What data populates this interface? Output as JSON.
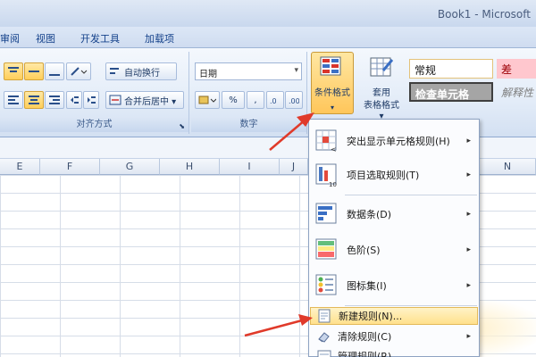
{
  "window": {
    "title": "Book1 - Microsoft"
  },
  "tabs": [
    {
      "label": "审阅"
    },
    {
      "label": "视图"
    },
    {
      "label": "开发工具"
    },
    {
      "label": "加载项"
    }
  ],
  "ribbon": {
    "alignment": {
      "wrap_text": "自动换行",
      "merge_center": "合并后居中 ▾",
      "label": "对齐方式"
    },
    "number": {
      "format_value": "日期",
      "percent": "%",
      "comma": ",",
      "label": "数字"
    },
    "styles": {
      "conditional_format": "条件格式",
      "table_format_line1": "套用",
      "table_format_line2": "表格格式 ▾",
      "normal": "常规",
      "bad": "差",
      "check_cell": "检查单元格",
      "explanatory": "解释性"
    }
  },
  "columns": [
    "E",
    "F",
    "G",
    "H",
    "I",
    "J",
    "N"
  ],
  "menu": {
    "items": [
      {
        "label": "突出显示单元格规则(H)",
        "has_submenu": true
      },
      {
        "label": "项目选取规则(T)",
        "has_submenu": true
      },
      {
        "label": "数据条(D)",
        "has_submenu": true
      },
      {
        "label": "色阶(S)",
        "has_submenu": true
      },
      {
        "label": "图标集(I)",
        "has_submenu": true
      }
    ],
    "simple_items": [
      {
        "label": "新建规则(N)..."
      },
      {
        "label": "清除规则(C)"
      },
      {
        "label": "管理规则(R)..."
      }
    ]
  },
  "colors": {
    "arrow": "#e03a2a",
    "bad_bg": "#ffc7ce",
    "bad_text": "#9c0006",
    "check_bg": "#a5a5a5",
    "accent": "#15428b"
  }
}
